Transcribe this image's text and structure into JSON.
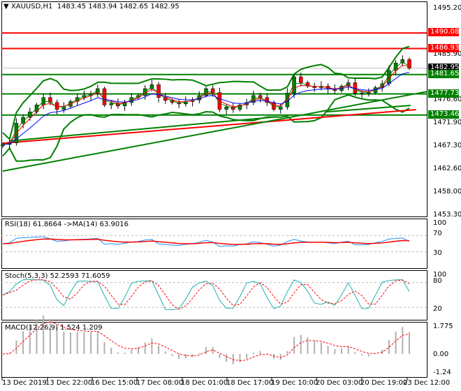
{
  "header": {
    "symbol": "XAUUSD,H1",
    "open": "1483.45",
    "high": "1483.94",
    "low": "1482.65",
    "close": "1482.95"
  },
  "price_axis": [
    "1495.20",
    "1485.90",
    "1476.60",
    "1471.90",
    "1467.30",
    "1462.60",
    "1458.00",
    "1453.30"
  ],
  "levels": [
    {
      "label": "1490.08",
      "price": 1490.08,
      "color": "#ff0000"
    },
    {
      "label": "1486.93",
      "price": 1486.93,
      "color": "#ff0000"
    },
    {
      "label": "1482.95",
      "price": 1482.95,
      "color": "#000000"
    },
    {
      "label": "1481.65",
      "price": 1481.65,
      "color": "#008000"
    },
    {
      "label": "1477.73",
      "price": 1477.73,
      "color": "#008000"
    },
    {
      "label": "1473.46",
      "price": 1473.46,
      "color": "#008000"
    }
  ],
  "indicators": {
    "rsi": {
      "label": "RSI(18) 61.8664  ->MA(14) 63.9016",
      "axis": [
        "100",
        "70",
        "30"
      ]
    },
    "stoch": {
      "label": "Stoch(5,3,3) 52.2593 71.6059",
      "axis": [
        "100",
        "80",
        "20"
      ]
    },
    "macd": {
      "label": "MACD(12,26,9) 1.524 1.209",
      "axis": [
        "1.775",
        "0.00",
        "-1.24"
      ]
    }
  },
  "time_axis": [
    "13 Dec 2019",
    "13 Dec 22:00",
    "16 Dec 15:00",
    "17 Dec 08:00",
    "18 Dec 01:00",
    "18 Dec 17:00",
    "19 Dec 10:00",
    "20 Dec 03:00",
    "20 Dec 19:00",
    "23 Dec 12:00"
  ],
  "chart_data": {
    "type": "candlestick",
    "title": "XAUUSD,H1",
    "ylim": [
      1453.3,
      1495.2
    ],
    "closes": [
      1467.5,
      1467.8,
      1471.8,
      1473.0,
      1474.1,
      1475.5,
      1477.0,
      1476.0,
      1474.6,
      1475.2,
      1476.2,
      1477.0,
      1477.4,
      1477.8,
      1478.8,
      1475.5,
      1475.8,
      1475.3,
      1476.0,
      1477.0,
      1477.4,
      1478.8,
      1479.6,
      1477.0,
      1476.4,
      1476.0,
      1475.7,
      1476.2,
      1476.5,
      1477.4,
      1478.8,
      1478.0,
      1474.6,
      1475.1,
      1474.6,
      1475.5,
      1476.0,
      1477.4,
      1477.0,
      1476.0,
      1474.6,
      1475.1,
      1477.9,
      1481.2,
      1480.0,
      1479.3,
      1479.0,
      1479.3,
      1478.8,
      1478.4,
      1479.3,
      1480.0,
      1477.9,
      1477.9,
      1478.0,
      1479.0,
      1479.8,
      1482.5,
      1484.0,
      1484.7,
      1482.95
    ],
    "trendlines": [
      {
        "color": "#ff0000",
        "from": [
          0,
          1467.75
        ],
        "to": [
          61,
          1474.55
        ]
      },
      {
        "color": "#008000",
        "from": [
          0,
          1462.1
        ],
        "to": [
          62.6,
          1478.2
        ]
      },
      {
        "color": "#008000",
        "from": [
          1,
          1468.2
        ],
        "to": [
          40.5,
          1473.1
        ]
      },
      {
        "color": "#008000",
        "from": [
          47.8,
          1474.1
        ],
        "to": [
          60.2,
          1475.4
        ]
      }
    ],
    "colors": {
      "bull": "#008000",
      "bear": "#ff0000",
      "ma_fast": "#ff0000",
      "ma_slow": "#0000ff",
      "bands": "#008000",
      "rsi": "#1e90ff",
      "stoch_main": "#20b2aa"
    }
  }
}
